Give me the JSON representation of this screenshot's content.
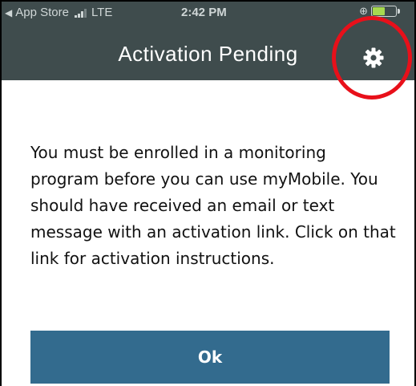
{
  "status_bar": {
    "back_label": "App Store",
    "network": "LTE",
    "time": "2:42 PM",
    "battery_percent": 55
  },
  "header": {
    "title": "Activation Pending",
    "settings_icon": "gear-icon"
  },
  "main": {
    "message": "You must be enrolled in a monitoring program before you can use myMobile. You should have received an email or text message with an activation link. Click on that link for activation instructions.",
    "ok_label": "Ok"
  },
  "colors": {
    "header_bg": "#3f4c4d",
    "button_bg": "#336b8e",
    "highlight": "#e8101a"
  }
}
